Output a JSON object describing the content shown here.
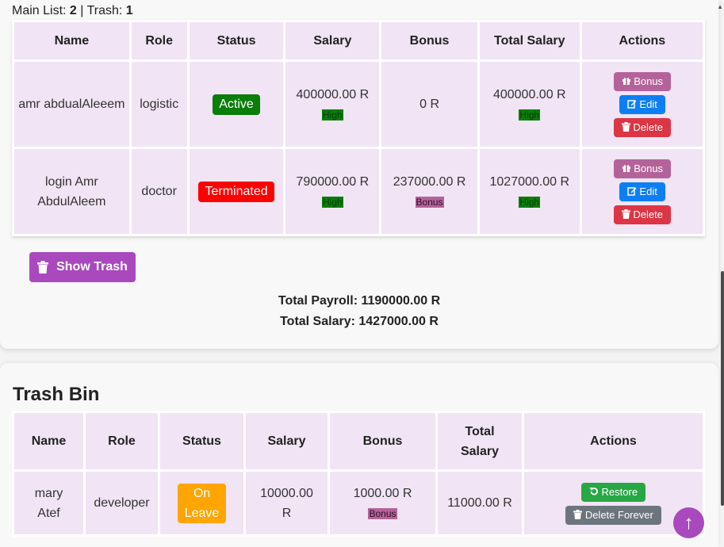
{
  "counts": {
    "main_label": "Main List:",
    "main_count": "2",
    "separator": "|",
    "trash_label": "Trash:",
    "trash_count": "1"
  },
  "main_table": {
    "headers": [
      "Name",
      "Role",
      "Status",
      "Salary",
      "Bonus",
      "Total Salary",
      "Actions"
    ],
    "rows": [
      {
        "name": "amr abdualAleeem",
        "role": "logistic",
        "status": "Active",
        "salary": "400000.00 R",
        "salary_tag": "High",
        "bonus": "0 R",
        "bonus_tag": "",
        "total": "400000.00 R",
        "total_tag": "High"
      },
      {
        "name": "login Amr AbdulAleem",
        "role": "doctor",
        "status": "Terminated",
        "salary": "790000.00 R",
        "salary_tag": "High",
        "bonus": "237000.00 R",
        "bonus_tag": "Bonus",
        "total": "1027000.00 R",
        "total_tag": "High"
      }
    ],
    "actions": {
      "bonus": "Bonus",
      "edit": "Edit",
      "delete": "Delete"
    }
  },
  "show_trash_label": "Show Trash",
  "totals": {
    "payroll": "Total Payroll: 1190000.00 R",
    "salary": "Total Salary: 1427000.00 R"
  },
  "trash": {
    "title": "Trash Bin",
    "headers": [
      "Name",
      "Role",
      "Status",
      "Salary",
      "Bonus",
      "Total Salary",
      "Actions"
    ],
    "rows": [
      {
        "name": "mary Atef",
        "role": "developer",
        "status": "On Leave",
        "salary": "10000.00 R",
        "bonus": "1000.00 R",
        "bonus_tag": "Bonus",
        "total": "11000.00 R"
      }
    ],
    "actions": {
      "restore": "Restore",
      "delete_forever": "Delete Forever"
    }
  },
  "scroll_top_label": "↑",
  "colors": {
    "active": "#0a7d0a",
    "terminated": "#ff0000",
    "on_leave": "#ffa500",
    "bonus_btn": "#b4639a",
    "edit_btn": "#0d7ff5",
    "delete_btn": "#dc3545",
    "restore_btn": "#28a745",
    "delete_forever_btn": "#6c757d",
    "accent": "#a949bd"
  },
  "icons": {
    "bonus": "gift-icon",
    "edit": "edit-icon",
    "delete": "trash-icon",
    "restore": "undo-icon",
    "show_trash": "trash-icon"
  }
}
